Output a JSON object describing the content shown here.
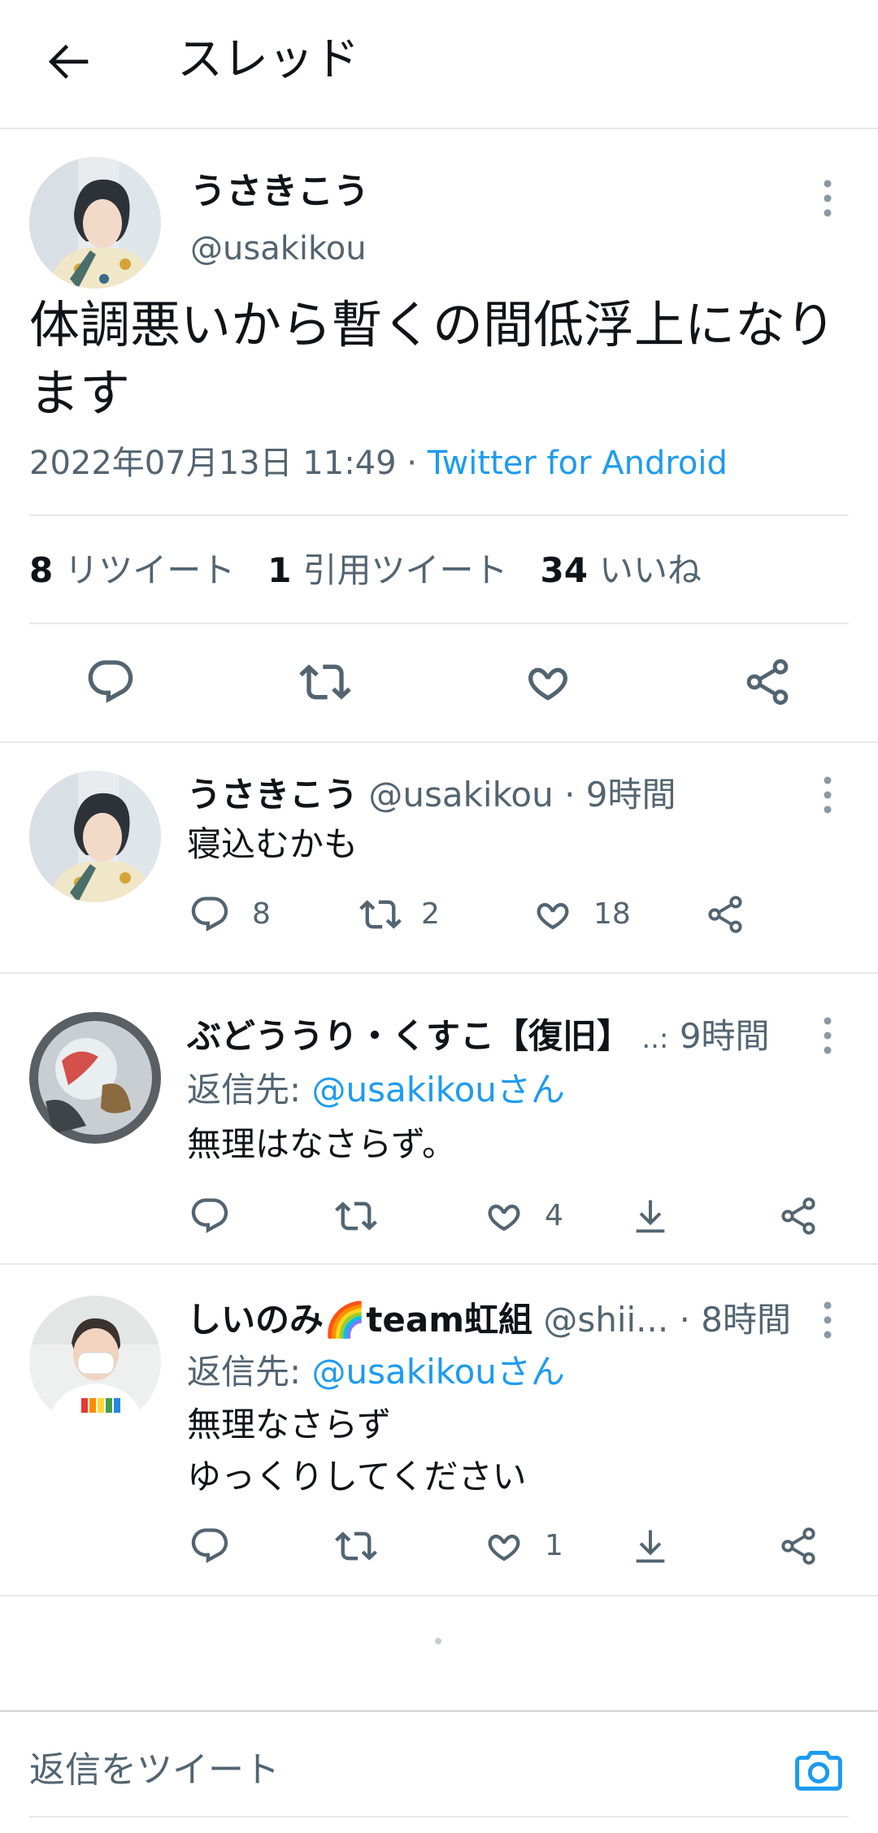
{
  "header": {
    "title": "スレッド"
  },
  "main_tweet": {
    "display_name": "うさきこう",
    "handle": "@usakikou",
    "text": "体調悪いから暫くの間低浮上になります",
    "timestamp": "2022年07月13日 11:49",
    "separator": " · ",
    "source": "Twitter for Android",
    "stats": [
      {
        "count": "8",
        "label": "リツイート"
      },
      {
        "count": "1",
        "label": "引用ツイート"
      },
      {
        "count": "34",
        "label": "いいね"
      }
    ]
  },
  "replies": [
    {
      "display_name": "うさきこう",
      "handle": "@usakikou",
      "time": "· 9時間",
      "text": "寝込むかも",
      "reply_count": "8",
      "retweet_count": "2",
      "like_count": "18"
    },
    {
      "display_name": "ぶどううり・くすこ【復旧】",
      "handle": "..:",
      "time": "9時間",
      "reply_to_label": "返信先:",
      "reply_to_user": "@usakikouさん",
      "text": "無理はなさらず。",
      "like_count": "4"
    },
    {
      "display_name": "しいのみ",
      "emoji": "🌈",
      "display_name_suffix": "team虹組",
      "handle": "@shii...",
      "time": "· 8時間",
      "reply_to_label": "返信先:",
      "reply_to_user": "@usakikouさん",
      "text_lines": [
        "無理なさらず",
        "ゆっくりしてください"
      ],
      "like_count": "1"
    }
  ],
  "composer": {
    "placeholder": "返信をツイート"
  },
  "icons": {
    "back": "arrow-left-icon",
    "more": "more-vertical-icon",
    "reply": "reply-icon",
    "retweet": "retweet-icon",
    "like": "heart-icon",
    "share": "share-icon",
    "download": "download-icon",
    "camera": "camera-icon"
  },
  "colors": {
    "accent": "#1d9bf0",
    "secondary_text": "#536471",
    "text": "#0f1419"
  }
}
